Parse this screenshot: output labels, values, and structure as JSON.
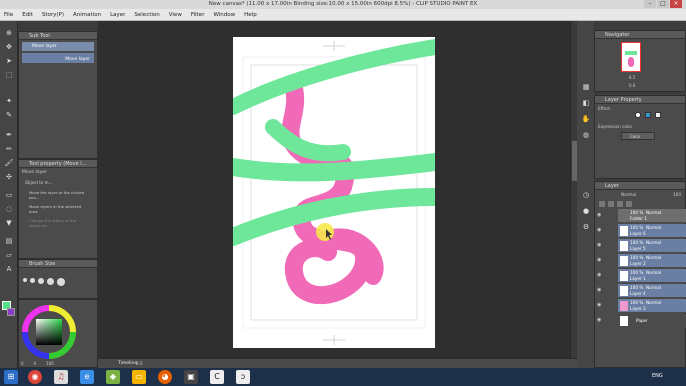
{
  "window": {
    "title": "New canvas* (11.00 x 17.00in Binding size:10.00 x 15.00in 600dpi 8.5%) - CLIP STUDIO PAINT EX"
  },
  "menu": [
    "File",
    "Edit",
    "Story(P)",
    "Animation",
    "Layer",
    "Selection",
    "View",
    "Filter",
    "Window",
    "Help"
  ],
  "subtool": {
    "header": "Sub Tool",
    "item1": "Move layer",
    "item2": "Move layer"
  },
  "tool_property": {
    "header": "Tool property (Move l...",
    "tool_name": "Move layer",
    "object_label": "Object to m...",
    "opt1": "Move the layer at the clicked pos...",
    "opt2": "Move layers in the selected area",
    "opt3": "Change the status of the object to..."
  },
  "brush_size": {
    "header": "Brush Size"
  },
  "color": {
    "main": "#57e08a",
    "sub": "#8a3cc8"
  },
  "color_wheel_values": [
    "0",
    "0",
    "100"
  ],
  "navigator": {
    "header": "Navigator",
    "zoom": "8.5",
    "angle": "0.0"
  },
  "layer_property": {
    "header": "Layer Property",
    "effect_label": "Effect",
    "expression_label": "Expression color",
    "expression_value": "Color"
  },
  "layer_panel": {
    "header": "Layer",
    "blend": "Normal",
    "opacity": "100",
    "layers": [
      {
        "pct": "100 %",
        "mode": "Normal",
        "name": "Folder 1"
      },
      {
        "pct": "100 %",
        "mode": "Normal",
        "name": "Layer 6"
      },
      {
        "pct": "100 %",
        "mode": "Normal",
        "name": "Layer 5"
      },
      {
        "pct": "100 %",
        "mode": "Normal",
        "name": "Layer 2"
      },
      {
        "pct": "100 %",
        "mode": "Normal",
        "name": "Layer 1"
      },
      {
        "pct": "100 %",
        "mode": "Normal",
        "name": "Layer 4"
      },
      {
        "pct": "100 %",
        "mode": "Normal",
        "name": "Layer 3"
      },
      {
        "pct": "",
        "mode": "",
        "name": "Paper"
      }
    ]
  },
  "statusbar": {
    "zoom": "8.5",
    "timeline": "Timeline"
  },
  "taskbar": {
    "lang": "ENG",
    "icons": [
      "start-icon",
      "chrome-icon",
      "itunes-icon",
      "explorer-icon",
      "android-icon",
      "folder-icon",
      "firefox-icon",
      "app-icon",
      "app-icon",
      "clip-studio-icon",
      "clip-studio-icon"
    ]
  }
}
